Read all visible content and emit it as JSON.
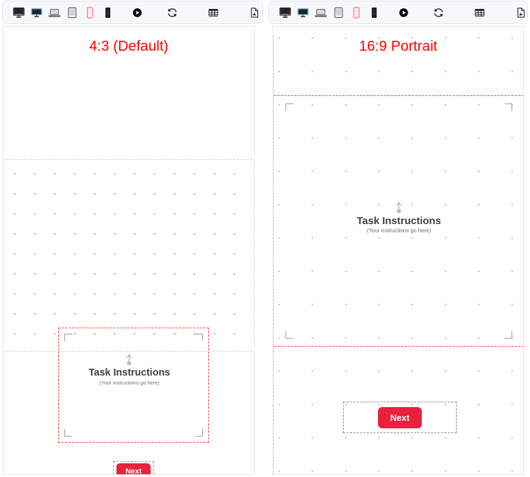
{
  "toolbar": {
    "items": [
      {
        "name": "desktop-monitor-icon",
        "label": "Desktop",
        "state": "default"
      },
      {
        "name": "monitor-icon",
        "label": "Monitor",
        "state": "default"
      },
      {
        "name": "laptop-icon",
        "label": "Laptop",
        "state": "default"
      },
      {
        "name": "tablet-icon",
        "label": "Tablet",
        "state": "default"
      },
      {
        "name": "mobile-icon",
        "label": "Mobile",
        "state": "active"
      },
      {
        "name": "mobile-filled-icon",
        "label": "Mobile Filled",
        "state": "filled"
      },
      {
        "name": "record-icon",
        "label": "Record",
        "state": "default"
      },
      {
        "name": "refresh-icon",
        "label": "Refresh",
        "state": "default"
      },
      {
        "name": "grid-icon",
        "label": "Grid",
        "state": "default"
      },
      {
        "name": "export-file-icon",
        "label": "Export",
        "state": "default"
      }
    ]
  },
  "panes": {
    "left": {
      "title": "4:3 (Default)",
      "instructions": {
        "heading": "Task Instructions",
        "subtext": "(Your instructions go here)"
      },
      "next_label": "Next"
    },
    "right": {
      "title": "16:9 Portrait",
      "instructions": {
        "heading": "Task Instructions",
        "subtext": "(Your instructions go here)"
      },
      "next_label": "Next"
    }
  },
  "colors": {
    "title_red": "#ff0000",
    "safe_area_red": "#ff3b3b",
    "button_red": "#e8213f",
    "grid_dot": "#b8b8b8",
    "guide_gray": "#cfcfcf",
    "accent_pink": "#ff7a9c"
  }
}
